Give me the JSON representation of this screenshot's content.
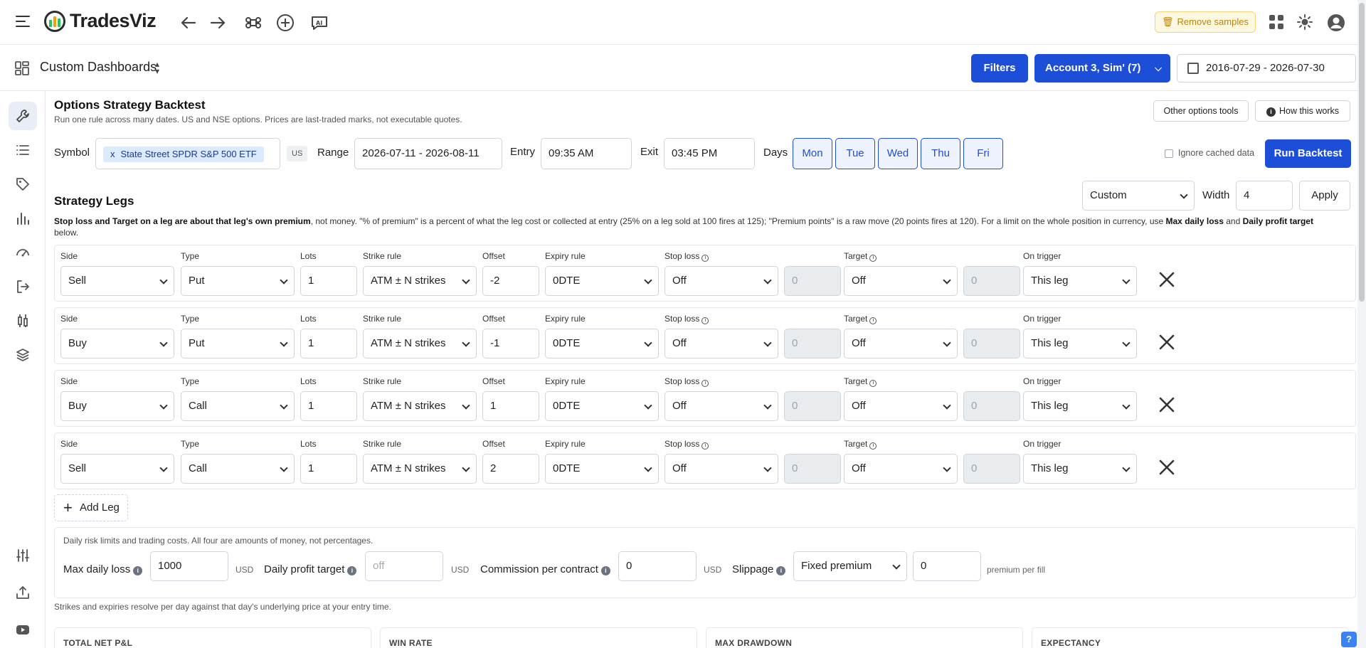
{
  "app": {
    "name": "TradesViz"
  },
  "header": {
    "remove_samples": "Remove samples"
  },
  "dashbar": {
    "title": "Custom Dashboards",
    "filters": "Filters",
    "account": "Account 3, Sim' (7)",
    "date_range": "2016-07-29 - 2026-07-30"
  },
  "page": {
    "title": "Options Strategy Backtest",
    "subtitle": "Run one rule across many dates. US and NSE options. Prices are last-traded marks, not executable quotes.",
    "other_tools": "Other options tools",
    "how_works": "How this works"
  },
  "controls": {
    "symbol_label": "Symbol",
    "symbol_chip_x": "x",
    "symbol_chip": "State Street SPDR S&P 500 ETF",
    "market": "US",
    "range_label": "Range",
    "range": "2026-07-11 - 2026-08-11",
    "entry_label": "Entry",
    "entry": "09:35  AM",
    "exit_label": "Exit",
    "exit": "03:45  PM",
    "days_label": "Days",
    "days": [
      "Mon",
      "Tue",
      "Wed",
      "Thu",
      "Fri"
    ],
    "ignore_cache": "Ignore cached data",
    "run": "Run Backtest"
  },
  "legs_section": {
    "title": "Strategy Legs",
    "preset": "Custom",
    "width_label": "Width",
    "width": "4",
    "apply": "Apply",
    "note_b1": "Stop loss and Target on a leg are about that leg's own premium",
    "note_t1": ", not money. \"% of premium\" is a percent of what the leg cost or collected at entry (25% on a leg sold at 100 fires at 125); \"Premium points\" is a raw move (20 points fires at 120). For a limit on the whole position in currency, use ",
    "note_b2": "Max daily loss",
    "note_t2": " and ",
    "note_b3": "Daily profit target",
    "note_t3": " below."
  },
  "leg_labels": {
    "side": "Side",
    "type": "Type",
    "lots": "Lots",
    "strike_rule": "Strike rule",
    "offset": "Offset",
    "expiry_rule": "Expiry rule",
    "stop_loss": "Stop loss",
    "target": "Target",
    "on_trigger": "On trigger"
  },
  "legs": [
    {
      "side": "Sell",
      "type": "Put",
      "lots": "1",
      "strike": "ATM ± N strikes",
      "offset": "-2",
      "expiry": "0DTE",
      "stop": "Off",
      "stop_val": "0",
      "target": "Off",
      "target_val": "0",
      "trigger": "This leg"
    },
    {
      "side": "Buy",
      "type": "Put",
      "lots": "1",
      "strike": "ATM ± N strikes",
      "offset": "-1",
      "expiry": "0DTE",
      "stop": "Off",
      "stop_val": "0",
      "target": "Off",
      "target_val": "0",
      "trigger": "This leg"
    },
    {
      "side": "Buy",
      "type": "Call",
      "lots": "1",
      "strike": "ATM ± N strikes",
      "offset": "1",
      "expiry": "0DTE",
      "stop": "Off",
      "stop_val": "0",
      "target": "Off",
      "target_val": "0",
      "trigger": "This leg"
    },
    {
      "side": "Sell",
      "type": "Call",
      "lots": "1",
      "strike": "ATM ± N strikes",
      "offset": "2",
      "expiry": "0DTE",
      "stop": "Off",
      "stop_val": "0",
      "target": "Off",
      "target_val": "0",
      "trigger": "This leg"
    }
  ],
  "add_leg": "Add Leg",
  "risk": {
    "desc": "Daily risk limits and trading costs. All four are amounts of money, not percentages.",
    "max_loss_label": "Max daily loss",
    "max_loss": "1000",
    "max_loss_unit": "USD",
    "profit_label": "Daily profit target",
    "profit_placeholder": "off",
    "profit_unit": "USD",
    "commission_label": "Commission per contract",
    "commission": "0",
    "commission_unit": "USD",
    "slippage_label": "Slippage",
    "slippage_mode": "Fixed premium",
    "slippage": "0",
    "slippage_unit": "premium per fill"
  },
  "resolve_note": "Strikes and expiries resolve per day against that day's underlying price at your entry time.",
  "stats": [
    "TOTAL NET P&L",
    "WIN RATE",
    "MAX DRAWDOWN",
    "EXPECTANCY"
  ],
  "help": "?"
}
